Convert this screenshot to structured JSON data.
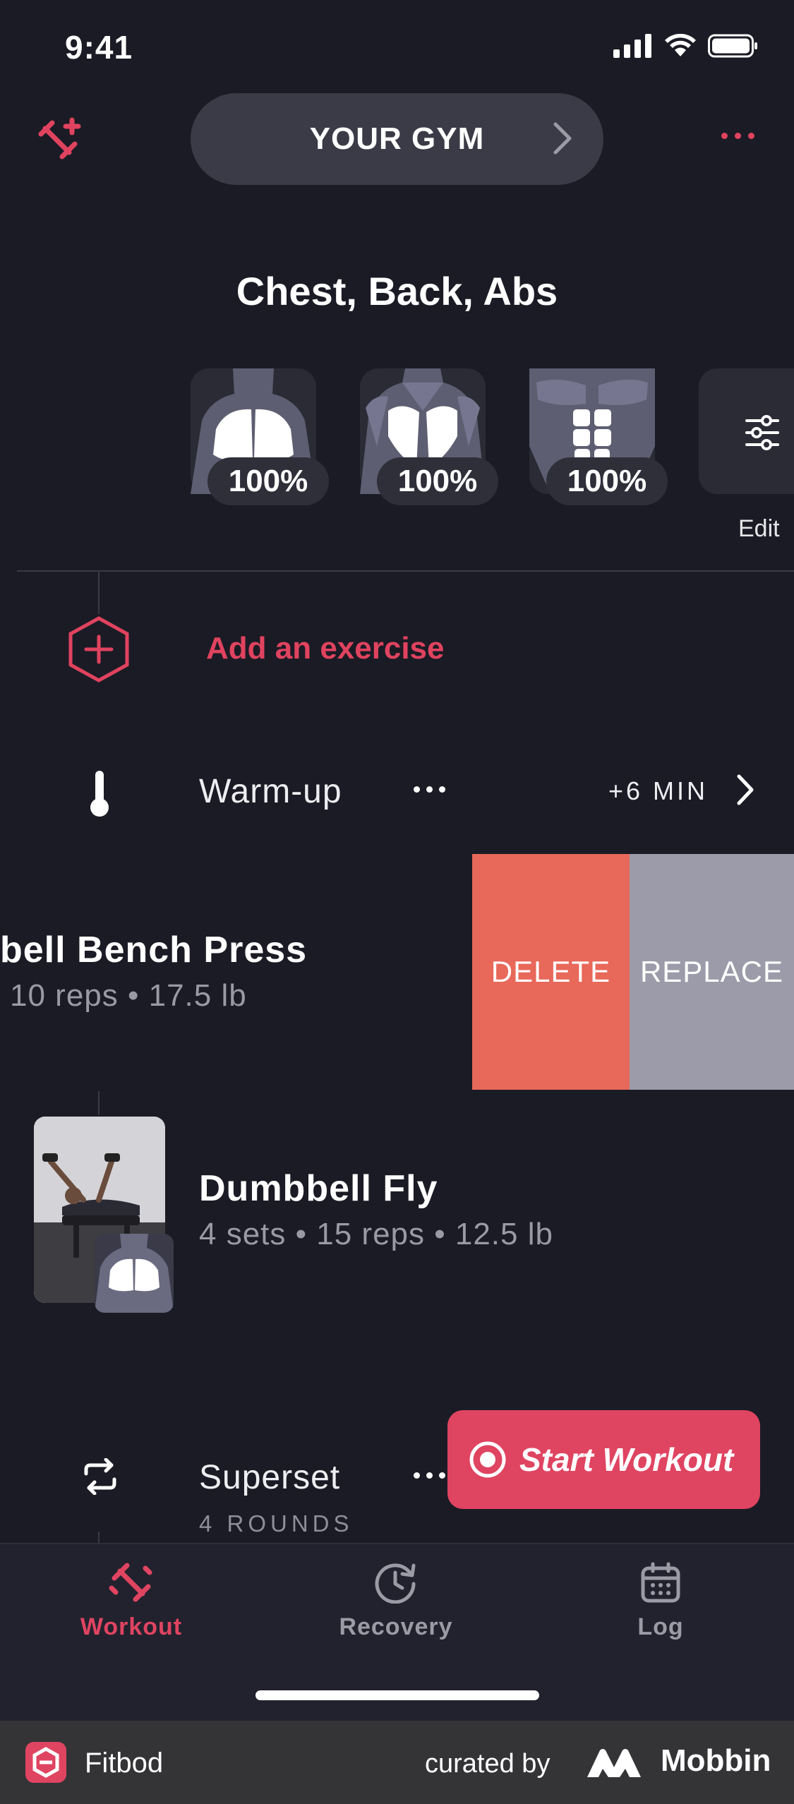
{
  "status": {
    "time": "9:41"
  },
  "header": {
    "gym_label": "YOUR GYM"
  },
  "page_title": "Chest, Back, Abs",
  "muscles": [
    {
      "name": "Chest",
      "percent": "100%"
    },
    {
      "name": "Back",
      "percent": "100%"
    },
    {
      "name": "Abs",
      "percent": "100%"
    }
  ],
  "edit_label": "Edit",
  "add_exercise": "Add an exercise",
  "warmup": {
    "label": "Warm-up",
    "duration": "+6 MIN"
  },
  "swiped_exercise": {
    "title": "bell Bench Press",
    "details": "10 reps • 17.5 lb",
    "delete_label": "DELETE",
    "replace_label": "REPLACE"
  },
  "exercise": {
    "title": "Dumbbell Fly",
    "details": "4 sets • 15 reps • 12.5 lb"
  },
  "superset": {
    "label": "Superset",
    "rounds": "4 ROUNDS"
  },
  "start_workout": "Start Workout",
  "tabs": [
    {
      "label": "Workout",
      "active": true
    },
    {
      "label": "Recovery",
      "active": false
    },
    {
      "label": "Log",
      "active": false
    }
  ],
  "footer": {
    "app_name": "Fitbod",
    "curated_by": "curated by",
    "brand": "Mobbin"
  },
  "colors": {
    "accent": "#df4461",
    "background": "#1b1b25",
    "delete": "#e8685a",
    "replace": "#9b9ba9"
  }
}
